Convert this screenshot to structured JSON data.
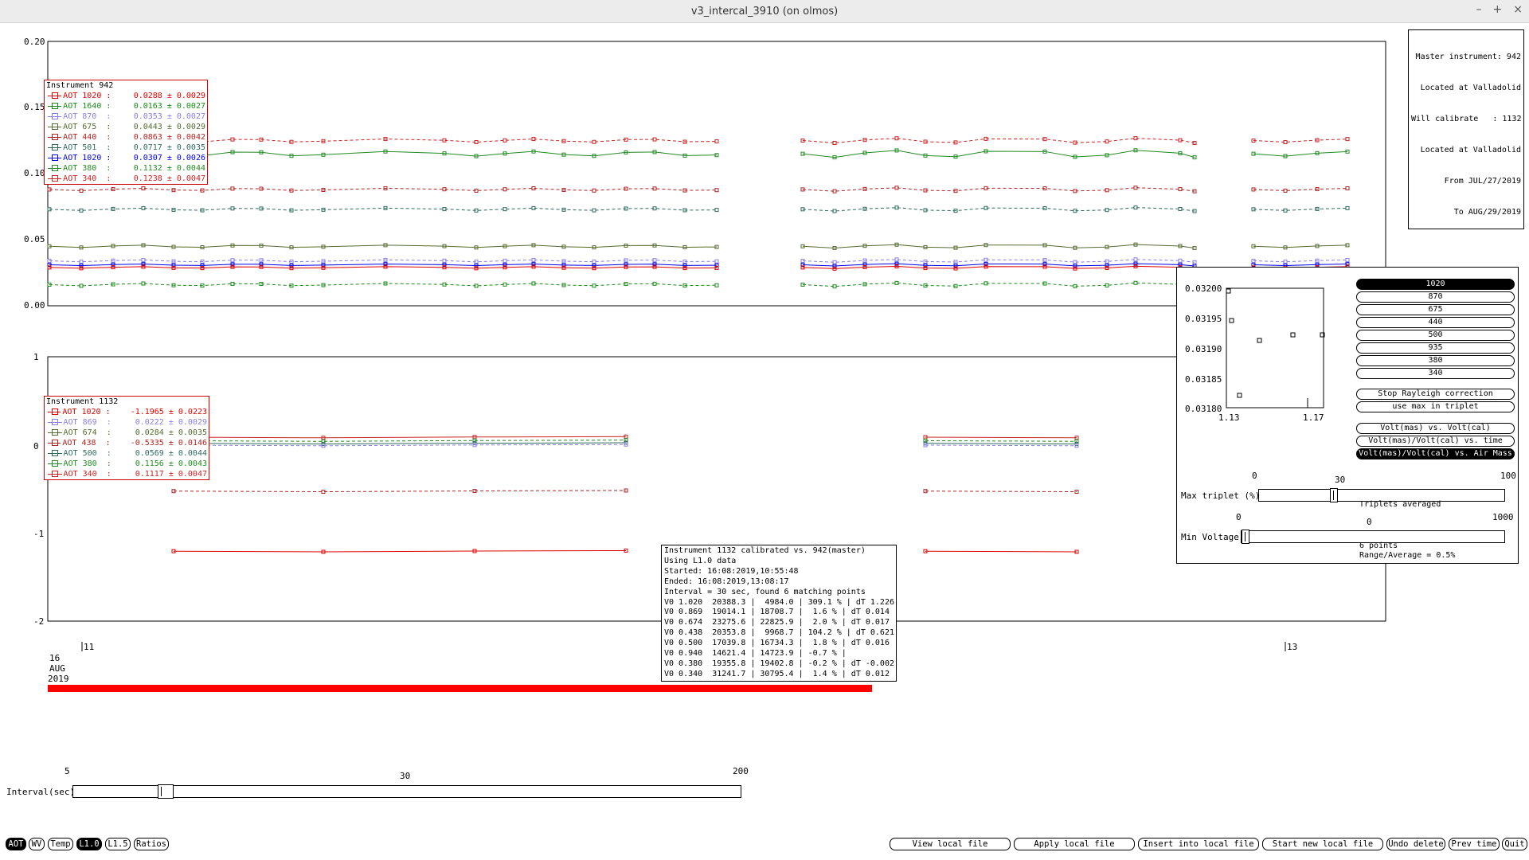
{
  "window": {
    "title": "v3_intercal_3910 (on olmos)",
    "controls": [
      "–",
      "+",
      "×"
    ]
  },
  "top_chart": {
    "y_ticks": [
      "0.20",
      "0.15",
      "0.10",
      "0.05",
      "0.00"
    ],
    "master_info": [
      "Master instrument: 942",
      "Located at Valladolid",
      "Will calibrate   : 1132",
      "Located at Valladolid",
      "From JUL/27/2019",
      "To AUG/29/2019"
    ]
  },
  "legend1": {
    "title": "Instrument 942",
    "items": [
      {
        "label": "AOT 1020 :",
        "value": "0.0288 ± 0.0029",
        "color": "#e00000"
      },
      {
        "label": "AOT 1640 :",
        "value": "0.0163 ± 0.0027",
        "color": "#1a8a1a"
      },
      {
        "label": "AOT 870  :",
        "value": "0.0353 ± 0.0027",
        "color": "#8a7fe8"
      },
      {
        "label": "AOT 675  :",
        "value": "0.0443 ± 0.0029",
        "color": "#556b2f"
      },
      {
        "label": "AOT 440  :",
        "value": "0.0863 ± 0.0042",
        "color": "#b22222"
      },
      {
        "label": "AOT 501  :",
        "value": "0.0717 ± 0.0035",
        "color": "#2e6b5e"
      },
      {
        "label": "AOT 1020 :",
        "value": "0.0307 ± 0.0026",
        "color": "#0000ee"
      },
      {
        "label": "AOT 380  :",
        "value": "0.1132 ± 0.0044",
        "color": "#228b22"
      },
      {
        "label": "AOT 340  :",
        "value": "0.1238 ± 0.0047",
        "color": "#cc2222"
      }
    ]
  },
  "mid_chart": {
    "y_ticks": [
      "1",
      "0",
      "-1",
      "-2"
    ]
  },
  "legend2": {
    "title": "Instrument 1132",
    "items": [
      {
        "label": "AOT 1020 :",
        "value": "-1.1965 ± 0.0223",
        "color": "#e00000"
      },
      {
        "label": "AOT 869  :",
        "value": "0.0222 ± 0.0029",
        "color": "#8a7fe8"
      },
      {
        "label": "AOT 674  :",
        "value": "0.0284 ± 0.0035",
        "color": "#556b2f"
      },
      {
        "label": "AOT 438  :",
        "value": "-0.5335 ± 0.0146",
        "color": "#b22222"
      },
      {
        "label": "AOT 500  :",
        "value": "0.0569 ± 0.0044",
        "color": "#2e6b5e"
      },
      {
        "label": "AOT 380  :",
        "value": "0.1156 ± 0.0043",
        "color": "#228b22"
      },
      {
        "label": "AOT 340  :",
        "value": "0.1117 ± 0.0047",
        "color": "#cc2222"
      }
    ]
  },
  "x_axis": {
    "tick1": "11",
    "tick2": "13",
    "date": [
      "16",
      "AUG",
      "2019"
    ]
  },
  "calib_info": [
    "Instrument 1132 calibrated vs. 942(master)",
    "Using L1.0 data",
    "Started: 16:08:2019,10:55:48",
    "Ended: 16:08:2019,13:08:17",
    "Interval = 30 sec, found 6 matching points",
    "V0 1.020  20388.3 |  4984.0 | 309.1 % | dT 1.226",
    "V0 0.869  19014.1 | 18708.7 |  1.6 % | dT 0.014",
    "V0 0.674  23275.6 | 22825.9 |  2.0 % | dT 0.017",
    "V0 0.438  20353.8 |  9968.7 | 104.2 % | dT 0.621",
    "V0 0.500  17039.8 | 16734.3 |  1.8 % | dT 0.016",
    "V0 0.940  14621.4 | 14723.9 | -0.7 % |",
    "V0 0.380  19355.8 | 19402.8 | -0.2 % | dT -0.002",
    "V0 0.340  31241.7 | 30795.4 |  1.4 % | dT 0.012"
  ],
  "panel": {
    "y_ticks": [
      "0.03200",
      "0.03195",
      "0.03190",
      "0.03185",
      "0.03180"
    ],
    "x_ticks": [
      "1.13",
      "1.17"
    ],
    "wavelengths": [
      "1020",
      "870",
      "675",
      "440",
      "500",
      "935",
      "380",
      "340"
    ],
    "selected_wavelength": "1020",
    "stop_rayleigh": "Stop Rayleigh correction",
    "use_max": "use max in triplet",
    "modes": [
      "Volt(mas) vs. Volt(cal)",
      "Volt(mas)/Volt(cal) vs. time",
      "Volt(mas)/Volt(cal) vs. Air Mass"
    ],
    "selected_mode": "Volt(mas)/Volt(cal) vs. Air Mass",
    "max_triplet": {
      "label": "Max triplet (%)",
      "min": "0",
      "max": "100",
      "value": "30",
      "value_fraction": 0.3,
      "note": "Triplets averaged"
    },
    "min_voltage": {
      "label": "Min Voltage",
      "min": "0",
      "max": "1000",
      "value": "0",
      "value_fraction": 0.0,
      "note": "6 points",
      "note2": "Range/Average = 0.5%"
    }
  },
  "interval": {
    "label": "Interval(sec)",
    "min": "5",
    "max": "200",
    "value": "30",
    "value_fraction": 0.13
  },
  "bottom_left": [
    "AOT",
    "WV",
    "Temp",
    "L1.0",
    "L1.5",
    "Ratios"
  ],
  "bottom_left_selected": [
    "AOT",
    "L1.0"
  ],
  "bottom_right": [
    "View local file",
    "Apply local file",
    "Insert into local file",
    "Start new local file",
    "Undo delete",
    "Prev time",
    "Quit"
  ]
}
